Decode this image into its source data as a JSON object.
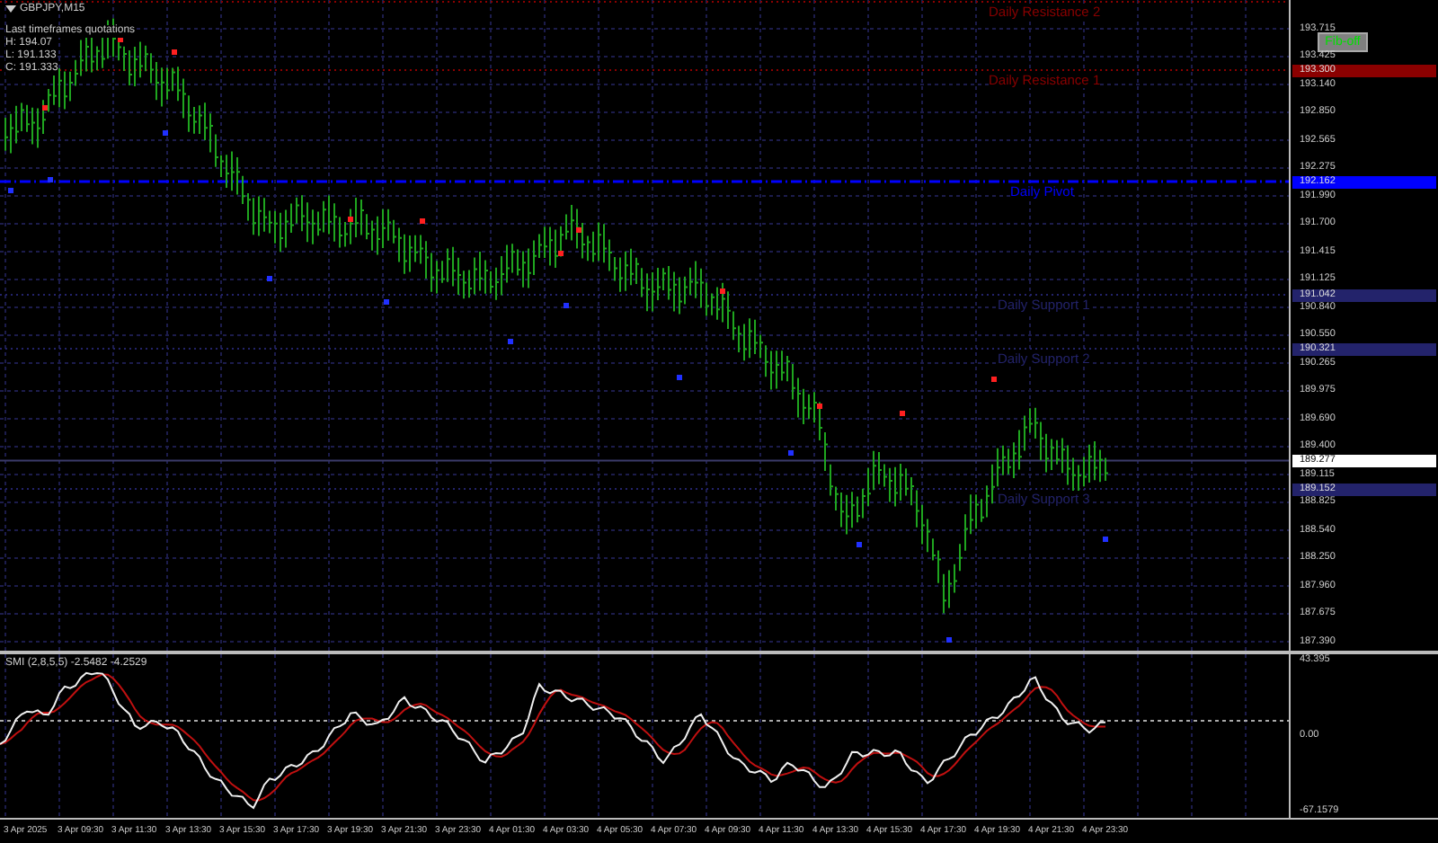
{
  "chart": {
    "symbol": "GBPJPY,M15",
    "quote_panel": {
      "title": "Last timeframes quotations",
      "lines": [
        "H: 194.07",
        "L: 191.133",
        "C: 191.333"
      ]
    },
    "fib_button": {
      "label": "Fib-off"
    },
    "levels": [
      {
        "label": "Daily Resistance 2",
        "kind": "resistance",
        "color": "#8b0000"
      },
      {
        "label": "Daily Resistance 1",
        "kind": "resistance",
        "color": "#8b0000",
        "tag": "193.300"
      },
      {
        "label": "Daily Pivot",
        "kind": "pivot",
        "color": "#0000ff",
        "tag": "192.162"
      },
      {
        "label": "Daily Support 1",
        "kind": "support",
        "color": "#23236b",
        "tag": "191.042"
      },
      {
        "label": "Daily Support 2",
        "kind": "support",
        "color": "#23236b",
        "tag": "190.321"
      },
      {
        "label": "Daily Support 3",
        "kind": "support",
        "color": "#23236b",
        "tag": "189.152"
      }
    ],
    "current_price": "189.277",
    "price_axis": [
      "193.715",
      "193.425",
      "193.140",
      "192.850",
      "192.565",
      "192.275",
      "191.990",
      "191.700",
      "191.415",
      "191.125",
      "190.840",
      "190.550",
      "190.265",
      "189.975",
      "189.690",
      "189.400",
      "189.115",
      "188.825",
      "188.540",
      "188.250",
      "187.960",
      "187.675",
      "187.390"
    ]
  },
  "indicator": {
    "label": "SMI (2,8,5,5) -2.5482 -4.2529",
    "axis": [
      "43.395",
      "0.00",
      "-67.1579"
    ]
  },
  "time_axis": [
    "3 Apr 2025",
    "3 Apr 09:30",
    "3 Apr 11:30",
    "3 Apr 13:30",
    "3 Apr 15:30",
    "3 Apr 17:30",
    "3 Apr 19:30",
    "3 Apr 21:30",
    "3 Apr 23:30",
    "4 Apr 01:30",
    "4 Apr 03:30",
    "4 Apr 05:30",
    "4 Apr 07:30",
    "4 Apr 09:30",
    "4 Apr 11:30",
    "4 Apr 13:30",
    "4 Apr 15:30",
    "4 Apr 17:30",
    "4 Apr 19:30",
    "4 Apr 21:30",
    "4 Apr 23:30"
  ]
}
